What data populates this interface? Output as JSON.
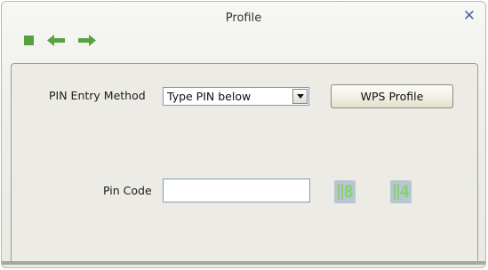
{
  "window": {
    "title": "Profile",
    "close_glyph": "✕"
  },
  "toolbar": {
    "stop_icon": "stop-icon",
    "back_icon": "back-arrow-icon",
    "forward_icon": "forward-arrow-icon",
    "icon_color": "#57a13f"
  },
  "form": {
    "pin_entry_label": "PIN Entry Method",
    "pin_entry_selected": "Type PIN below",
    "wps_profile_button": "WPS Profile",
    "pin_code_label": "Pin Code",
    "pin_code_value": "",
    "pin_mode_8_label": "8",
    "pin_mode_4_label": "4"
  }
}
